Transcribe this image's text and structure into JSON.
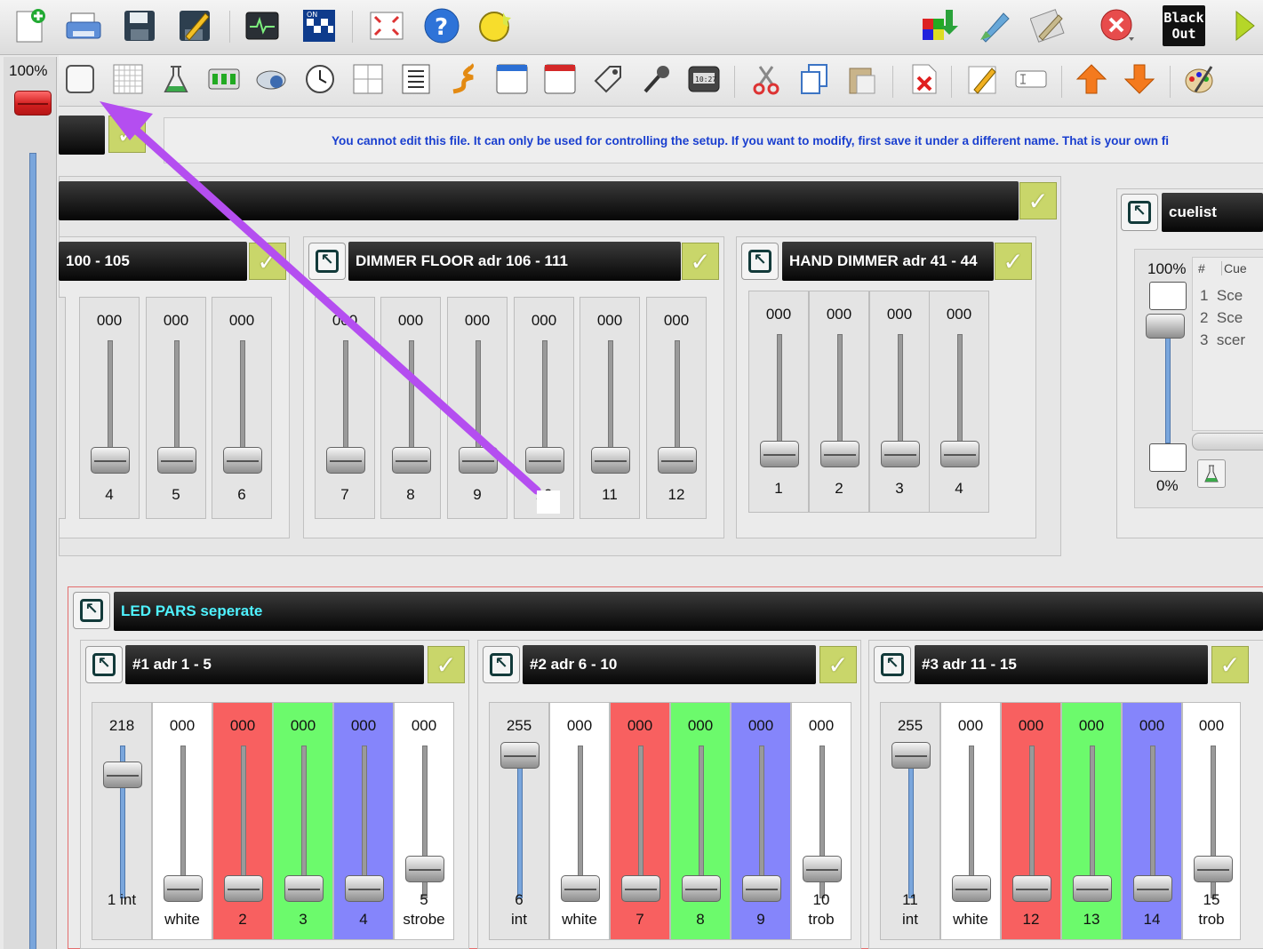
{
  "toolbar_main": {
    "icons": [
      "new-file-icon",
      "print-icon",
      "save-icon",
      "save-as-icon",
      "monitor-icon",
      "dmx-onoff-icon",
      "fullscreen-icon",
      "help-icon",
      "lightbulb-icon",
      "color-download-icon",
      "paint-icon",
      "edit-icon",
      "close-icon",
      "blackout-icon",
      "play-icon"
    ],
    "blackout_label_1": "Black",
    "blackout_label_2": "Out"
  },
  "toolbar_widgets": {
    "icons": [
      "button-widget-icon",
      "grid-widget-icon",
      "cuelist-widget-icon",
      "effect-widget-icon",
      "speed-widget-icon",
      "clock-widget-icon",
      "frame-widget-icon",
      "list-widget-icon",
      "sequence-widget-icon",
      "window-widget-icon",
      "red-window-widget-icon",
      "tag-widget-icon",
      "mic-widget-icon",
      "timer-widget-icon",
      "cut-icon",
      "copy-icon",
      "paste-icon",
      "delete-icon",
      "pencil-icon",
      "text-field-icon",
      "up-arrow-icon",
      "down-arrow-icon",
      "palette-icon"
    ],
    "timer_text": "10:27"
  },
  "master": {
    "percent": "100%",
    "level": 1.0
  },
  "info": {
    "message": "You cannot edit this file. It can only be used for controlling the setup. If you want to modify, first save it under a different name. That is your own fi"
  },
  "dimmer_groups": [
    {
      "title": "100 - 105"
    },
    {
      "title": "DIMMER FLOOR adr 106 - 111"
    },
    {
      "title": "HAND DIMMER  adr 41 - 44"
    }
  ],
  "faders_row1": [
    {
      "value": "000",
      "num": "4"
    },
    {
      "value": "000",
      "num": "5"
    },
    {
      "value": "000",
      "num": "6"
    },
    {
      "value": "000",
      "num": "7"
    },
    {
      "value": "000",
      "num": "8"
    },
    {
      "value": "000",
      "num": "9"
    },
    {
      "value": "000",
      "num": "10"
    },
    {
      "value": "000",
      "num": "11"
    },
    {
      "value": "000",
      "num": "12"
    },
    {
      "value": "000",
      "num": "1"
    },
    {
      "value": "000",
      "num": "2"
    },
    {
      "value": "000",
      "num": "3"
    },
    {
      "value": "000",
      "num": "4"
    }
  ],
  "cuelist": {
    "title": "cuelist",
    "top_pct": "100%",
    "bottom_pct": "0%",
    "col_hash": "#",
    "col_cue": "Cue",
    "rows": [
      {
        "n": "1",
        "cue": "Sce"
      },
      {
        "n": "2",
        "cue": "Sce"
      },
      {
        "n": "3",
        "cue": "scer"
      }
    ]
  },
  "led": {
    "title": "LED PARS seperate",
    "pars": [
      {
        "title": "#1  adr 1 - 5"
      },
      {
        "title": "#2  adr 6 - 10"
      },
      {
        "title": "#3  adr 11 - 15"
      }
    ],
    "channels": [
      {
        "value": "218",
        "num": "1 int",
        "label": "",
        "color": "#e4e4e4",
        "level": 0.855
      },
      {
        "value": "000",
        "num": "",
        "label": "white",
        "color": "#ffffff",
        "level": 0
      },
      {
        "value": "000",
        "num": "",
        "label": "2",
        "color": "#f86060",
        "level": 0
      },
      {
        "value": "000",
        "num": "",
        "label": "3",
        "color": "#6cfa6c",
        "level": 0
      },
      {
        "value": "000",
        "num": "",
        "label": "4",
        "color": "#8585fb",
        "level": 0
      },
      {
        "value": "000",
        "num": "5",
        "label": "strobe",
        "color": "#ffffff",
        "level": 0.15
      },
      {
        "value": "255",
        "num": "6",
        "label": "int",
        "color": "#e4e4e4",
        "level": 1.0
      },
      {
        "value": "000",
        "num": "",
        "label": "white",
        "color": "#ffffff",
        "level": 0
      },
      {
        "value": "000",
        "num": "",
        "label": "7",
        "color": "#f86060",
        "level": 0
      },
      {
        "value": "000",
        "num": "",
        "label": "8",
        "color": "#6cfa6c",
        "level": 0
      },
      {
        "value": "000",
        "num": "",
        "label": "9",
        "color": "#8585fb",
        "level": 0
      },
      {
        "value": "000",
        "num": "10",
        "label": "trob",
        "color": "#ffffff",
        "level": 0.15
      },
      {
        "value": "255",
        "num": "11",
        "label": "int",
        "color": "#e4e4e4",
        "level": 1.0
      },
      {
        "value": "000",
        "num": "",
        "label": "white",
        "color": "#ffffff",
        "level": 0
      },
      {
        "value": "000",
        "num": "",
        "label": "12",
        "color": "#f86060",
        "level": 0
      },
      {
        "value": "000",
        "num": "",
        "label": "13",
        "color": "#6cfa6c",
        "level": 0
      },
      {
        "value": "000",
        "num": "",
        "label": "14",
        "color": "#8585fb",
        "level": 0
      },
      {
        "value": "000",
        "num": "15",
        "label": "trob",
        "color": "#ffffff",
        "level": 0.15
      }
    ]
  },
  "colors": {
    "accent_check": "#c9d66a",
    "arrow": "#b44ef0",
    "info_text": "#1a3fcf",
    "led_title": "#4ff2ff"
  }
}
